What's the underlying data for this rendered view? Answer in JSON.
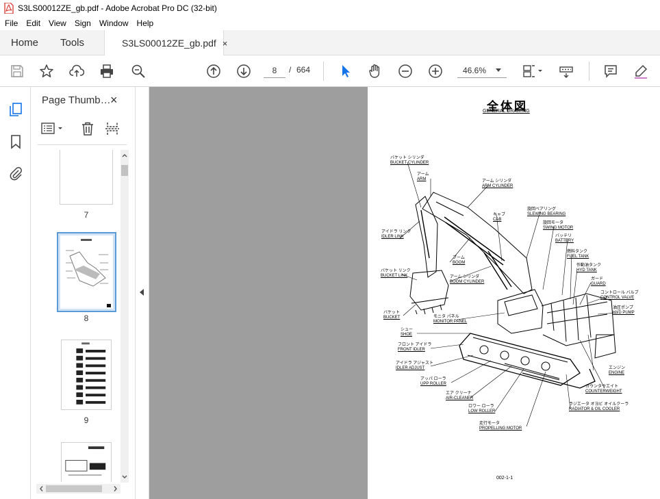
{
  "window": {
    "title": "S3LS00012ZE_gb.pdf - Adobe Acrobat Pro DC (32-bit)"
  },
  "menu": [
    "File",
    "Edit",
    "View",
    "Sign",
    "Window",
    "Help"
  ],
  "tabs": {
    "home": "Home",
    "tools": "Tools",
    "document": "S3LS00012ZE_gb.pdf",
    "close": "×"
  },
  "toolbar": {
    "page_current": "8",
    "page_sep": "/",
    "page_total": "664",
    "zoom": "46.6%"
  },
  "panel": {
    "title": "Page Thumb…",
    "close": "×",
    "thumbnails": [
      {
        "label": "7"
      },
      {
        "label": "8",
        "selected": true
      },
      {
        "label": "9"
      }
    ]
  },
  "document": {
    "title_jp": "全体図",
    "title_en": "GENERAL DRAWING",
    "page_number": "002-1-1",
    "labels": [
      {
        "jp": "バケット シリンダ",
        "en": "BUCKET CYLINDER"
      },
      {
        "jp": "アーム",
        "en": "ARM"
      },
      {
        "jp": "アーム シリンダ",
        "en": "ARM CYLINDER"
      },
      {
        "jp": "キャブ",
        "en": "CAB"
      },
      {
        "jp": "旋回ベアリング",
        "en": "SLEWING BEARING"
      },
      {
        "jp": "旋回モータ",
        "en": "SWING MOTOR"
      },
      {
        "jp": "バッテリ",
        "en": "BATTERY"
      },
      {
        "jp": "燃料タンク",
        "en": "FUEL TANK"
      },
      {
        "jp": "作動油タンク",
        "en": "HYD TANK"
      },
      {
        "jp": "ガード",
        "en": "GUARD"
      },
      {
        "jp": "コントロール バルブ",
        "en": "CONTROL VALVE"
      },
      {
        "jp": "油圧ポンプ",
        "en": "HYD PUMP"
      },
      {
        "jp": "アイドラ リンク",
        "en": "IDLER LINK"
      },
      {
        "jp": "ブーム",
        "en": "BOOM"
      },
      {
        "jp": "バケット リンク",
        "en": "BUCKET LINK"
      },
      {
        "jp": "アーム シリンダ",
        "en": "BOOM CYLINDER"
      },
      {
        "jp": "バケット",
        "en": "BUCKET"
      },
      {
        "jp": "モニタ パネル",
        "en": "MONITOR PANEL"
      },
      {
        "jp": "シュー",
        "en": "SHOE"
      },
      {
        "jp": "フロント アイドラ",
        "en": "FRONT IDLER"
      },
      {
        "jp": "アイドラ アジャスト",
        "en": "IDLER ADJUST"
      },
      {
        "jp": "アッパ ローラ",
        "en": "UPP ROLLER"
      },
      {
        "jp": "エア クリーナ",
        "en": "AIR-CLEANER"
      },
      {
        "jp": "ロワー ローラ",
        "en": "LOW ROLLER"
      },
      {
        "jp": "走行モータ",
        "en": "PROPELLING MOTOR"
      },
      {
        "jp": "エンジン",
        "en": "ENGINE"
      },
      {
        "jp": "カウンタウエイト",
        "en": "COUNTERWEIGHT"
      },
      {
        "jp": "ラジエータ オヨビ オイルクーラ",
        "en": "RADIATOR & OIL COOLER"
      }
    ]
  }
}
